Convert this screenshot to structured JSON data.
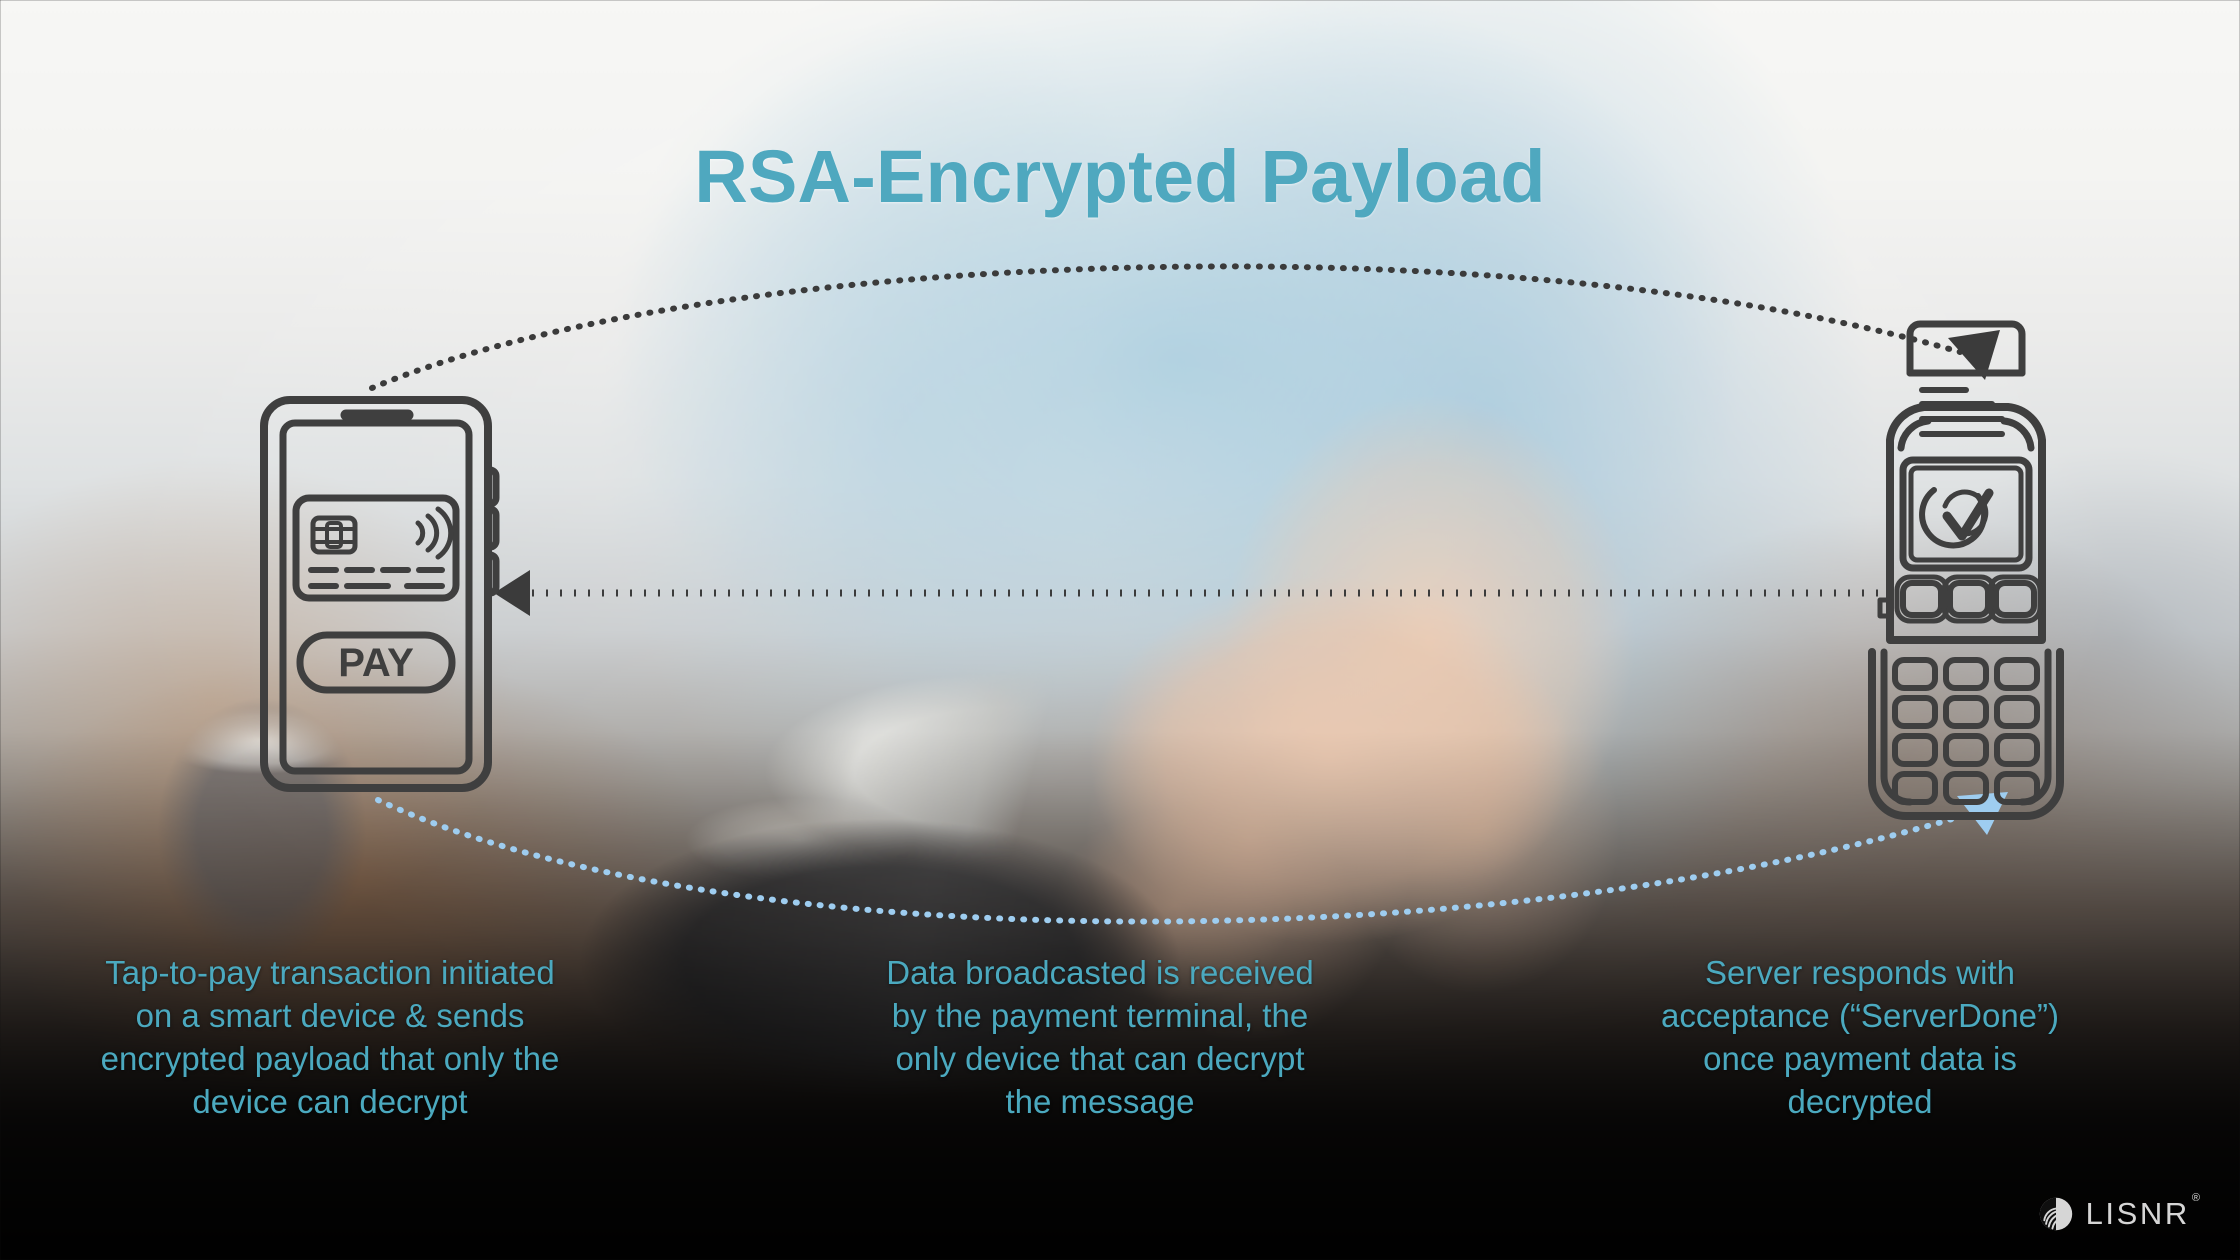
{
  "title": "RSA-Encrypted Payload",
  "theme": {
    "title_color": "#4FA8BF",
    "caption_color": "#4BA9BF",
    "icon_stroke": "#3f3f3f",
    "arrow_dark": "#3b3b3b",
    "arrow_blue": "#9ecdf0",
    "logo_color": "#e9e9e9"
  },
  "icons": {
    "phone": {
      "name": "smart-phone-tap-to-pay",
      "pay_button_label": "PAY",
      "card_label": "credit-card-contactless"
    },
    "terminal": {
      "name": "payment-terminal",
      "screen_label": "checkmark-approved",
      "receipt_label": "receipt"
    }
  },
  "arrows": [
    {
      "id": "arc-top",
      "label": "encrypted payload broadcast from device to terminal",
      "direction": "left-to-right",
      "style": "dotted-dark"
    },
    {
      "id": "line-middle",
      "label": "terminal to device channel",
      "direction": "right-to-left",
      "style": "dotted-dark"
    },
    {
      "id": "arc-bottom",
      "label": "server acceptance response to terminal",
      "direction": "left-to-right",
      "style": "dotted-blue"
    }
  ],
  "captions": {
    "left": "Tap-to-pay transaction initiated on a smart device & sends encrypted payload that only the device can decrypt",
    "middle": "Data broadcasted is received by the payment terminal, the only device that can decrypt the message",
    "right": "Server responds with acceptance (“ServerDone”) once payment data is decrypted"
  },
  "logo": {
    "wordmark": "LISNR",
    "trademark": "®",
    "mark_name": "lisnr-soundwave-mark"
  }
}
